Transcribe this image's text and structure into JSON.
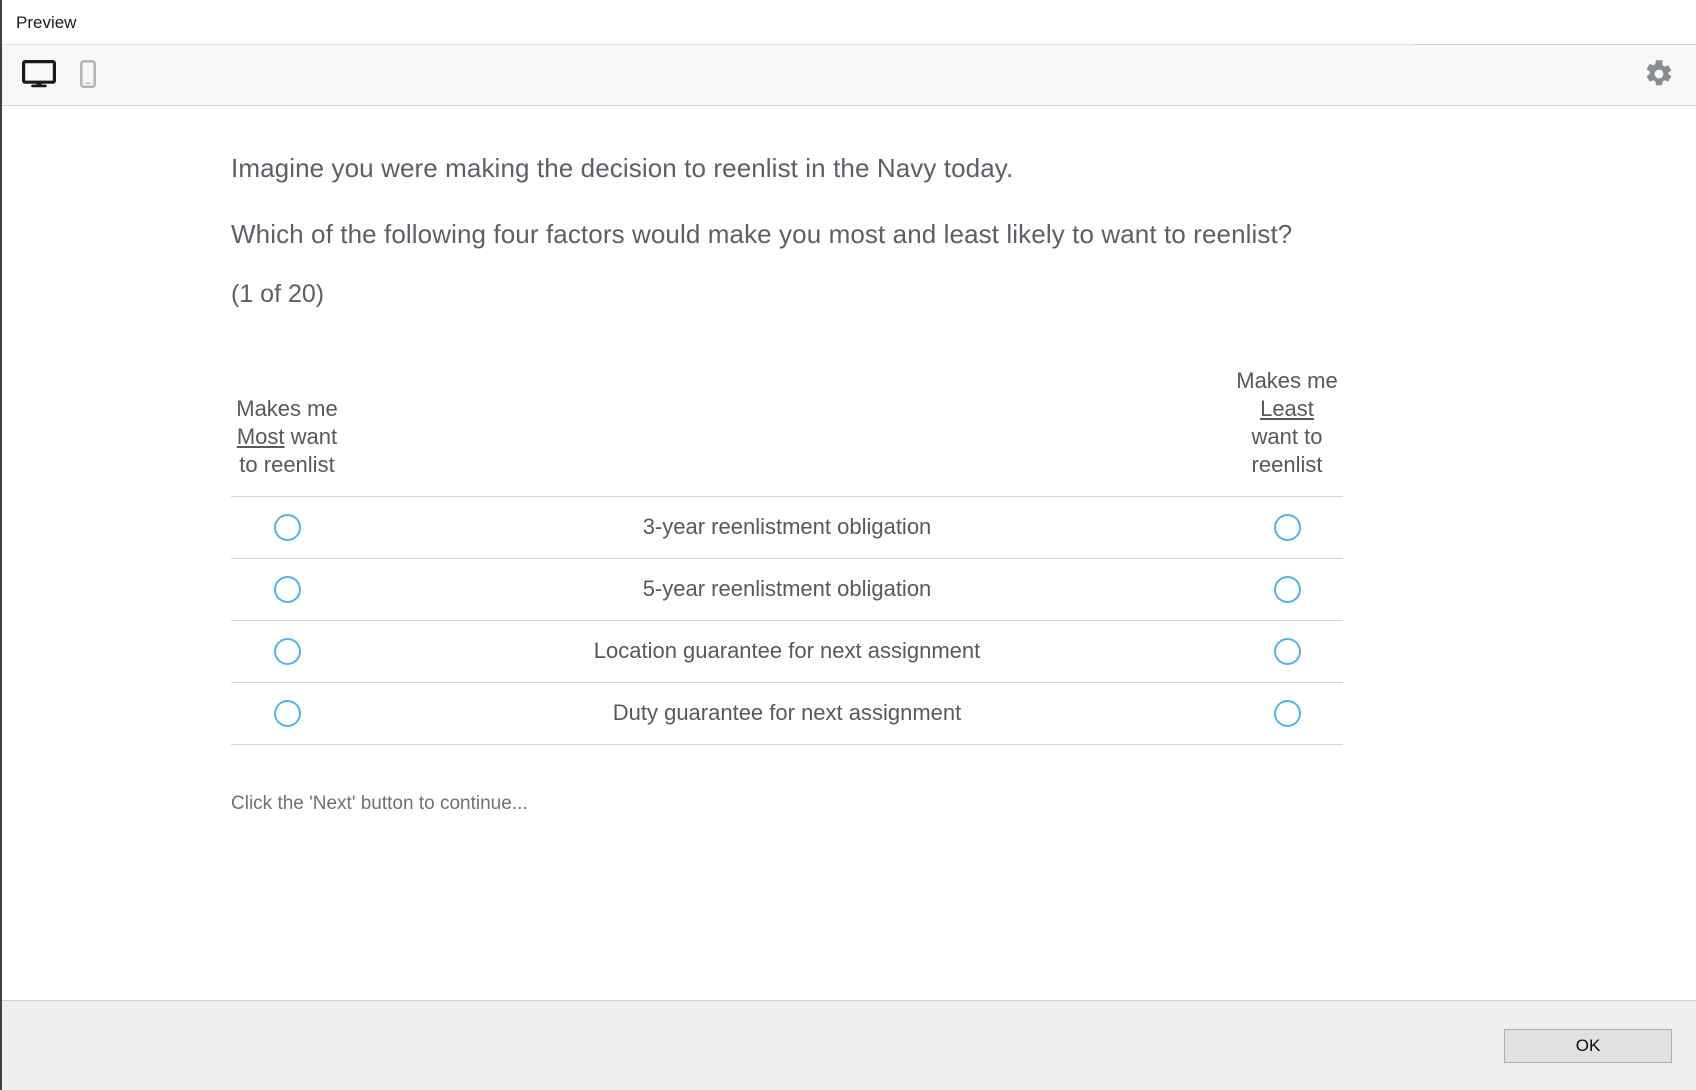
{
  "window": {
    "title": "Preview"
  },
  "toolbar": {
    "desktop_icon": "desktop-monitor-icon",
    "mobile_icon": "mobile-phone-icon",
    "settings_icon": "gear-icon",
    "desktop_active": true,
    "mobile_active": false
  },
  "survey": {
    "intro": "Imagine you were making the decision to reenlist in the Navy today.",
    "question": "Which of the following four factors would make you most and least likely to want to reenlist?",
    "counter": "(1 of 20)",
    "headers": {
      "left_line1": "Makes me",
      "left_emphasis": "Most",
      "left_line2_rest": " want",
      "left_line3": "to reenlist",
      "right_line1": "Makes me",
      "right_emphasis": "Least",
      "right_line2": "want to",
      "right_line3": "reenlist"
    },
    "items": [
      {
        "label": "3-year reenlistment obligation",
        "most_selected": false,
        "least_selected": false
      },
      {
        "label": "5-year reenlistment obligation",
        "most_selected": false,
        "least_selected": false
      },
      {
        "label": "Location guarantee for next assignment",
        "most_selected": false,
        "least_selected": false
      },
      {
        "label": "Duty guarantee for next assignment",
        "most_selected": false,
        "least_selected": false
      }
    ],
    "hint": "Click the 'Next' button to continue..."
  },
  "footer": {
    "ok_label": "OK"
  },
  "colors": {
    "radio_border": "#52b3e4",
    "text": "#58595b",
    "toolbar_bg": "#f8f8f8",
    "footer_bg": "#efefef"
  }
}
